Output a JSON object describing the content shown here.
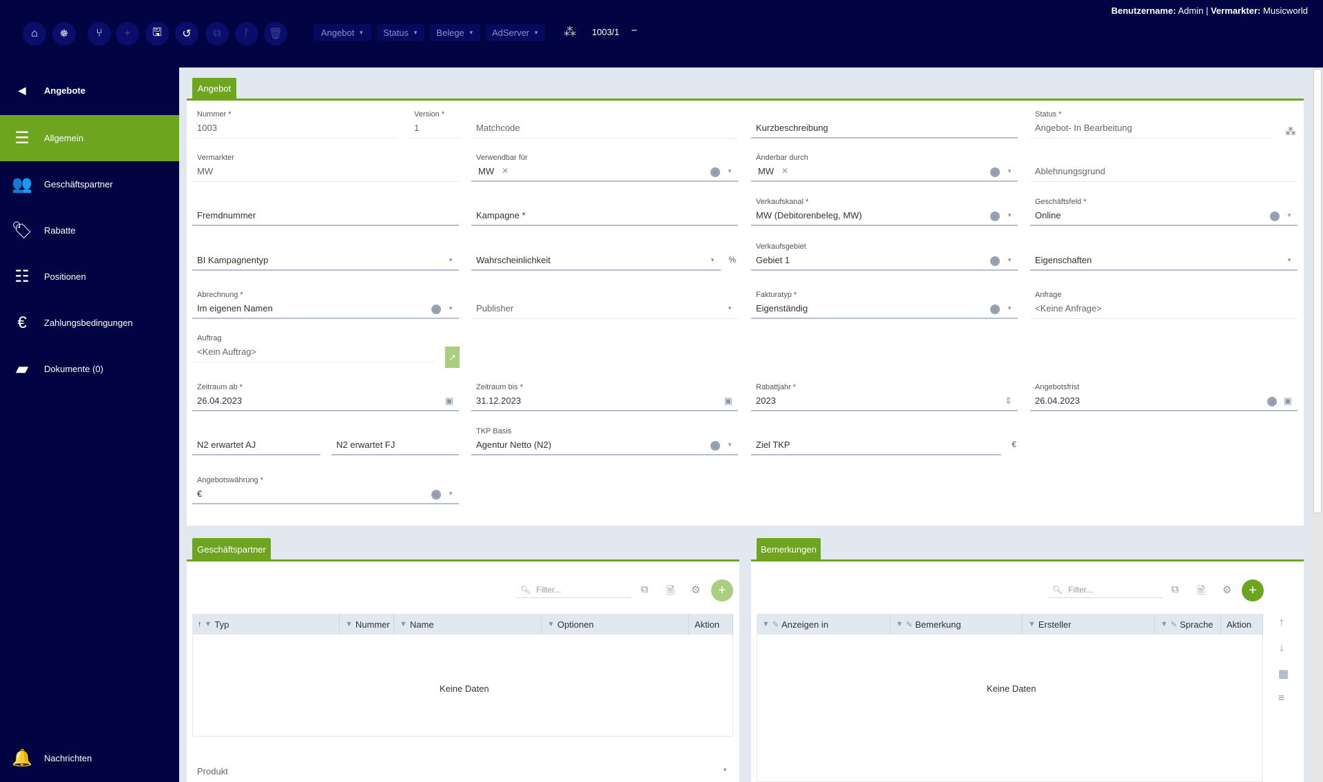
{
  "topbar": {
    "buttons": [
      {
        "icon": "home-icon",
        "glyph": "⌂"
      },
      {
        "icon": "helm-icon",
        "glyph": "✵"
      },
      {
        "icon": "branch-icon",
        "glyph": "⑂"
      },
      {
        "icon": "add-icon",
        "glyph": "+"
      },
      {
        "icon": "save-icon",
        "glyph": "🖫"
      },
      {
        "icon": "undo-icon",
        "glyph": "↺"
      },
      {
        "icon": "copy-icon",
        "glyph": "⧉"
      },
      {
        "icon": "fork-icon",
        "glyph": "ᚠ"
      },
      {
        "icon": "delete-icon",
        "glyph": "🗑"
      }
    ],
    "menus": [
      "Angebot",
      "Status",
      "Belege",
      "AdServer"
    ],
    "doc_number": "1003/1",
    "minus": "−",
    "user_label": "Benutzername:",
    "user": "Admin",
    "separator": "|",
    "marketer_label": "Vermarkter:",
    "marketer": "Musicworld"
  },
  "sidebar": {
    "back_label": "Angebote",
    "items": [
      {
        "label": "Allgemein",
        "icon": "menu-icon",
        "glyph": "☰"
      },
      {
        "label": "Geschäftspartner",
        "icon": "partners-icon",
        "glyph": "👥"
      },
      {
        "label": "Rabatte",
        "icon": "price-tag-icon",
        "glyph": "🏷"
      },
      {
        "label": "Positionen",
        "icon": "list-icon",
        "glyph": "☷"
      },
      {
        "label": "Zahlungsbedingungen",
        "icon": "payment-terms-icon",
        "glyph": "€"
      },
      {
        "label": "Dokumente (0)",
        "icon": "folder-icon",
        "glyph": "▰"
      }
    ],
    "notifications_label": "Nachrichten",
    "notifications_icon": "bell-icon"
  },
  "form": {
    "tab": "Angebot",
    "fields": {
      "nummer": {
        "label": "Nummer *",
        "value": "1003"
      },
      "version": {
        "label": "Version *",
        "value": "1"
      },
      "matchcode": {
        "label": "",
        "value": "Matchcode"
      },
      "kurzbeschreibung": {
        "label": "",
        "value": "Kurzbeschreibung"
      },
      "status": {
        "label": "Status *",
        "value": "Angebot- In Bearbeitung"
      },
      "vermarkter": {
        "label": "Vermarkter",
        "value": "MW"
      },
      "verwendbar": {
        "label": "Verwendbar für",
        "value": "MW",
        "chip": true,
        "icons": [
          "clear",
          "dropdown"
        ]
      },
      "aenderbar": {
        "label": "Änderbar durch",
        "value": "MW",
        "chip": true,
        "icons": [
          "clear",
          "dropdown"
        ]
      },
      "ablehnungsgrund": {
        "label": "",
        "value": "Ablehnungsgrund"
      },
      "fremdnummer": {
        "label": "",
        "value": "Fremdnummer"
      },
      "kampagne": {
        "label": "",
        "value": "Kampagne *"
      },
      "verkaufskanal": {
        "label": "Verkaufskanal *",
        "value": "MW (Debitorenbeleg, MW)",
        "icons": [
          "clear",
          "dropdown"
        ]
      },
      "geschaeftsfeld": {
        "label": "Geschäftsfeld *",
        "value": "Online",
        "icons": [
          "clear",
          "dropdown"
        ]
      },
      "bi_kampagnentyp": {
        "label": "",
        "value": "BI Kampagnentyp",
        "icons": [
          "dropdown"
        ]
      },
      "wahrscheinlichkeit": {
        "label": "",
        "value": "Wahrscheinlichkeit",
        "icons": [
          "dropdown"
        ],
        "suffix": "%"
      },
      "verkaufsgebiet": {
        "label": "Verkaufsgebiet",
        "value": "Gebiet 1",
        "icons": [
          "clear",
          "dropdown"
        ]
      },
      "eigenschaften": {
        "label": "",
        "value": "Eigenschaften",
        "icons": [
          "dropdown"
        ]
      },
      "abrechnung": {
        "label": "Abrechnung *",
        "value": "Im eigenen Namen",
        "icons": [
          "clear",
          "dropdown"
        ]
      },
      "publisher": {
        "label": "",
        "value": "Publisher",
        "icons": [
          "dropdown"
        ]
      },
      "fakturatyp": {
        "label": "Fakturatyp *",
        "value": "Eigenständig",
        "icons": [
          "clear",
          "dropdown"
        ]
      },
      "anfrage": {
        "label": "Anfrage",
        "value": "<Keine Anfrage>"
      },
      "auftrag": {
        "label": "Auftrag",
        "value": "<Kein Auftrag>"
      },
      "zeitraum_ab": {
        "label": "Zeitraum ab *",
        "value": "26.04.2023",
        "icons": [
          "calendar"
        ]
      },
      "zeitraum_bis": {
        "label": "Zeitraum bis *",
        "value": "31.12.2023",
        "icons": [
          "calendar"
        ]
      },
      "rabattjahr": {
        "label": "Rabattjahr *",
        "value": "2023",
        "icons": [
          "spinner"
        ]
      },
      "angebotsfrist": {
        "label": "Angebotsfrist",
        "value": "26.04.2023",
        "icons": [
          "clear",
          "calendar"
        ]
      },
      "n2_aj": {
        "label": "",
        "value": "N2 erwartet AJ"
      },
      "n2_fj": {
        "label": "",
        "value": "N2 erwartet FJ"
      },
      "tkp_basis": {
        "label": "TKP Basis",
        "value": "Agentur Netto (N2)",
        "icons": [
          "clear",
          "dropdown"
        ]
      },
      "ziel_tkp": {
        "label": "",
        "value": "Ziel TKP",
        "suffix": "€"
      },
      "waehrung": {
        "label": "Angebotswährung *",
        "value": "€",
        "icons": [
          "clear",
          "dropdown"
        ]
      }
    },
    "status_spinner_icon": "loading-icon",
    "auftrag_link_icon": "external-link-icon"
  },
  "partners": {
    "tab": "Geschäftspartner",
    "filter_placeholder": "Filter...",
    "columns": [
      "Typ",
      "Nummer",
      "Name",
      "Optionen",
      "Aktion"
    ],
    "empty": "Keine Daten",
    "produkt": "Produkt",
    "plus_color": "#a9cf7e"
  },
  "remarks": {
    "tab": "Bemerkungen",
    "filter_placeholder": "Filter...",
    "columns": [
      "Anzeigen in",
      "Bemerkung",
      "Ersteller",
      "Sprache",
      "Aktion"
    ],
    "empty": "Keine Daten",
    "plus_color": "#6ea51e"
  },
  "colors": {
    "navy": "#010342",
    "green": "#6ea51e",
    "background": "#e1e8f0"
  }
}
